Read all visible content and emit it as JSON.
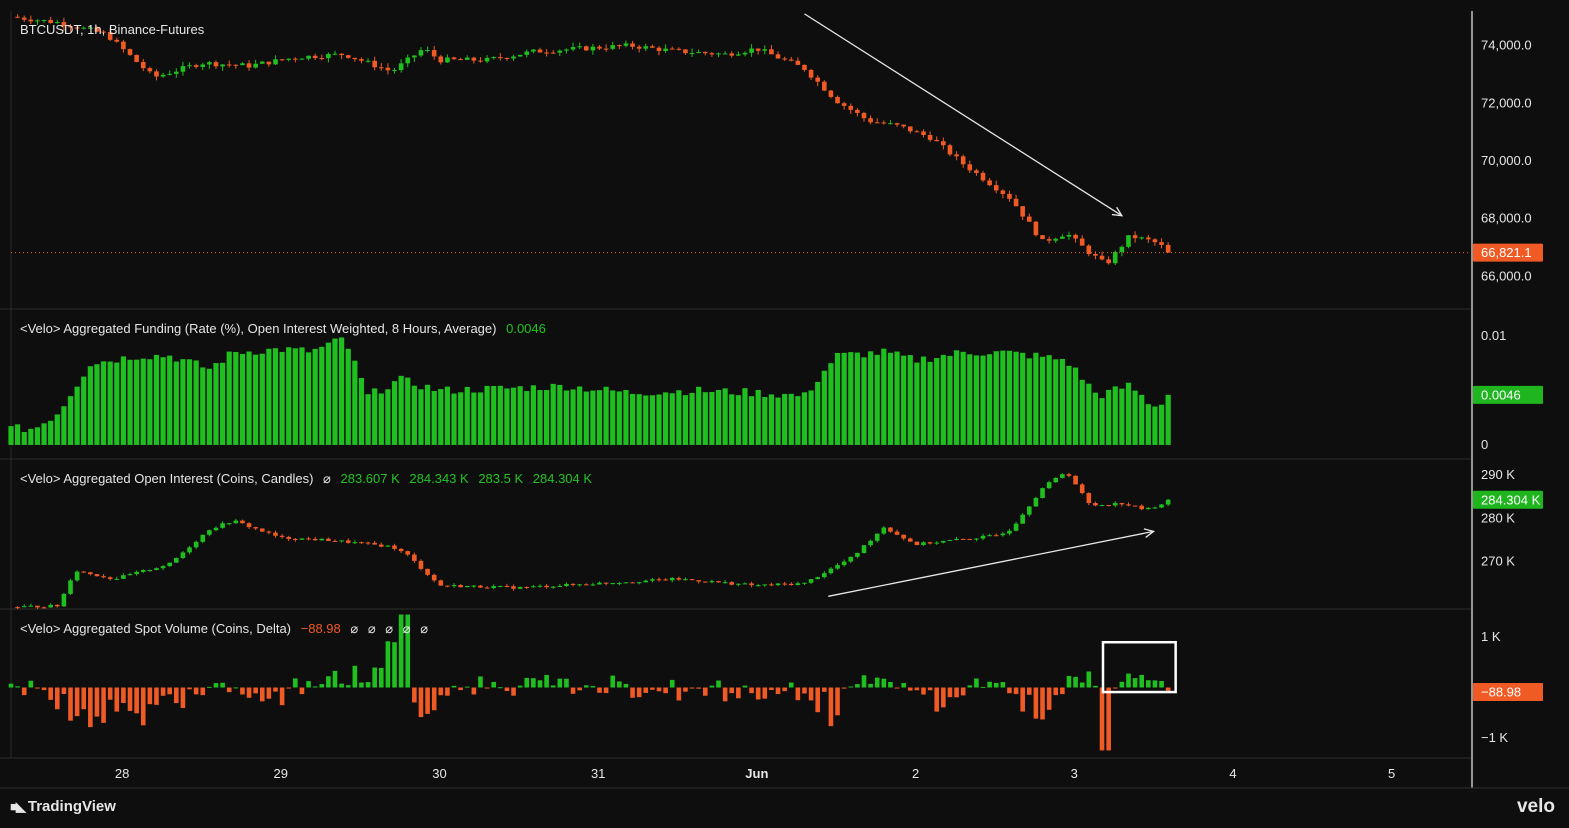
{
  "colors": {
    "up": "#1fbf1f",
    "down": "#f05a24",
    "bg": "#0e0e0e",
    "grid": "#2a2a2a",
    "axis_text": "#e6e6e6"
  },
  "price_pane": {
    "title": "BTCUSDT, 1h, Binance-Futures",
    "last_price_label": "66,821.1"
  },
  "funding_pane": {
    "title": "<Velo> Aggregated Funding (Rate (%), Open Interest Weighted, 8 Hours, Average)",
    "value": "0.0046",
    "badge": "0.0046"
  },
  "oi_pane": {
    "title": "<Velo> Aggregated Open Interest (Coins, Candles)",
    "icon": "eye-off-icon",
    "values": [
      "283.607 K",
      "284.343 K",
      "283.5 K",
      "284.304 K"
    ],
    "badge": "284.304 K"
  },
  "volume_pane": {
    "title": "<Velo> Aggregated Spot Volume (Coins, Delta)",
    "value": "−88.98",
    "icons": [
      "eye-off-icon",
      "eye-off-icon",
      "eye-off-icon",
      "eye-off-icon",
      "eye-off-icon"
    ],
    "badge": "−88.98"
  },
  "footer": {
    "brand_left": "TradingView",
    "brand_right": "velo"
  },
  "chart_data": [
    {
      "type": "line",
      "name": "price",
      "y_ticks": [
        "74,000.0",
        "72,000.0",
        "70,000.0",
        "68,000.0",
        "66,000.0"
      ],
      "y_tick_values": [
        74000,
        72000,
        70000,
        68000,
        66000
      ],
      "ylim": [
        64900,
        75200
      ],
      "x_ticks": [
        "28",
        "29",
        "30",
        "31",
        "Jun",
        "2",
        "3",
        "4",
        "5"
      ],
      "x_tick_values": [
        28,
        29,
        30,
        31,
        32,
        33,
        34,
        35,
        36
      ],
      "xlim": [
        27.3,
        36.5
      ],
      "x_anchor_days": [
        27.3,
        27.6,
        27.9,
        28.2,
        28.5,
        28.8,
        29.1,
        29.4,
        29.7,
        29.9,
        30.0,
        30.3,
        30.6,
        30.9,
        31.2,
        31.5,
        31.8,
        32.0,
        32.3,
        32.5,
        32.7,
        32.9,
        33.1,
        33.3,
        33.6,
        33.8,
        33.95,
        34.1,
        34.2,
        34.35,
        34.5,
        34.62
      ],
      "close_anchor": [
        75000,
        74800,
        74400,
        72900,
        73400,
        73300,
        73600,
        73700,
        73100,
        73900,
        73500,
        73500,
        73800,
        73900,
        74000,
        73800,
        73700,
        73900,
        73200,
        72100,
        71400,
        71200,
        70800,
        69900,
        68700,
        67200,
        67500,
        66800,
        66400,
        67400,
        67200,
        66821
      ],
      "last_price": 66821.1,
      "annotation": "down arrow drawn from (Jun 1, 75.1k) to (Jun 3.3, 68.1k)"
    },
    {
      "type": "bar",
      "name": "funding",
      "y_ticks": [
        "0.01",
        "0"
      ],
      "y_tick_values": [
        0.01,
        0
      ],
      "ylim": [
        -0.0012,
        0.0124
      ],
      "x_anchor_days": [
        27.3,
        27.45,
        27.6,
        27.8,
        28.1,
        28.3,
        28.55,
        28.7,
        29.0,
        29.2,
        29.4,
        29.55,
        29.75,
        30.0,
        30.4,
        30.8,
        31.2,
        31.6,
        32.0,
        32.3,
        32.5,
        32.8,
        33.0,
        33.3,
        33.55,
        33.75,
        33.95,
        34.15,
        34.35,
        34.5,
        34.62
      ],
      "value_anchor": [
        0.0015,
        0.0015,
        0.003,
        0.0075,
        0.0082,
        0.0082,
        0.007,
        0.0085,
        0.0088,
        0.0086,
        0.0098,
        0.0045,
        0.006,
        0.005,
        0.0052,
        0.0054,
        0.0048,
        0.005,
        0.0048,
        0.0045,
        0.0082,
        0.0085,
        0.0078,
        0.0085,
        0.0085,
        0.0082,
        0.0078,
        0.0045,
        0.0055,
        0.0035,
        0.0046
      ],
      "last_value": 0.0046
    },
    {
      "type": "line",
      "name": "open_interest",
      "y_ticks": [
        "290 K",
        "280 K",
        "270 K"
      ],
      "y_tick_values": [
        290,
        280,
        270
      ],
      "ylim": [
        259.3,
        293.5
      ],
      "x_anchor_days": [
        27.3,
        27.6,
        27.7,
        27.95,
        28.3,
        28.55,
        28.7,
        29.0,
        29.3,
        29.7,
        29.8,
        30.0,
        30.5,
        31.0,
        31.5,
        32.0,
        32.3,
        32.6,
        32.8,
        33.0,
        33.5,
        33.6,
        33.8,
        33.95,
        34.1,
        34.3,
        34.45,
        34.62
      ],
      "value_anchor": [
        259.5,
        259.8,
        268,
        266,
        269.5,
        277.5,
        279.5,
        275.5,
        275,
        273.5,
        271.5,
        264.5,
        264,
        265,
        266,
        264.5,
        265,
        271,
        278,
        274,
        276,
        277.5,
        287,
        291,
        283,
        283.5,
        282,
        284.304
      ],
      "annotation": "up arrow drawn from (Jun 1.45, 262k) to (Jun 3.5, 277k)"
    },
    {
      "type": "bar",
      "name": "spot_volume_delta",
      "y_ticks": [
        "1 K",
        "−1 K"
      ],
      "y_tick_values": [
        1000,
        -1000
      ],
      "ylim": [
        -1400,
        1540
      ],
      "x_anchor_days": [
        27.3,
        27.5,
        27.7,
        28.2,
        28.6,
        29.0,
        29.3,
        29.55,
        29.72,
        29.78,
        29.85,
        30.2,
        30.6,
        31.0,
        31.6,
        32.2,
        32.45,
        32.7,
        32.9,
        33.1,
        33.4,
        33.6,
        33.75,
        33.95,
        34.1,
        34.2,
        34.3,
        34.45,
        34.62
      ],
      "value_anchor": [
        50,
        -200,
        -1000,
        -700,
        150,
        -300,
        300,
        250,
        900,
        1450,
        -650,
        100,
        100,
        60,
        -80,
        -100,
        -950,
        550,
        150,
        -600,
        200,
        -250,
        -800,
        250,
        500,
        -1250,
        750,
        250,
        -88.98
      ],
      "highlight_box_days": [
        34.2,
        34.62
      ],
      "last_value": -88.98
    }
  ]
}
